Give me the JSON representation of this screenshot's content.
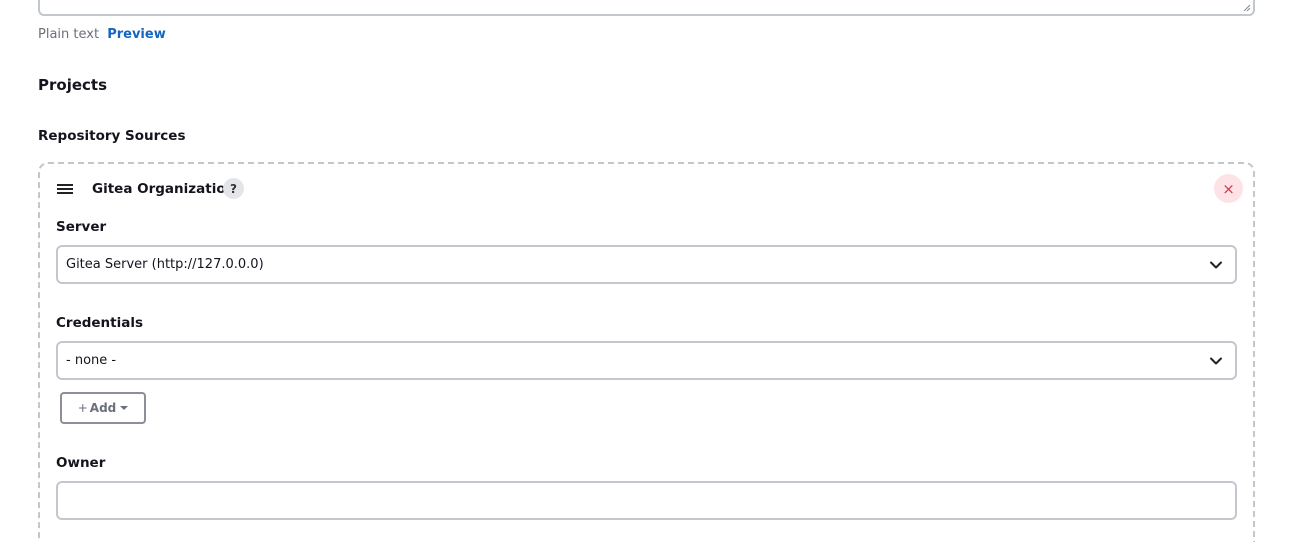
{
  "text_format": {
    "plain_label": "Plain text",
    "preview_label": "Preview"
  },
  "projects": {
    "title": "Projects"
  },
  "repository_sources": {
    "title": "Repository Sources",
    "block": {
      "title": "Gitea Organization",
      "help_symbol": "?",
      "remove_symbol": "×",
      "server": {
        "label": "Server",
        "selected": "Gitea Server (http://127.0.0.0)"
      },
      "credentials": {
        "label": "Credentials",
        "selected": "- none -",
        "add_label": "Add",
        "add_prefix": "+"
      },
      "owner": {
        "label": "Owner",
        "value": ""
      }
    }
  },
  "colors": {
    "link": "#1565c0",
    "remove": "#d43a4a",
    "remove_bg": "#fde3e6"
  }
}
